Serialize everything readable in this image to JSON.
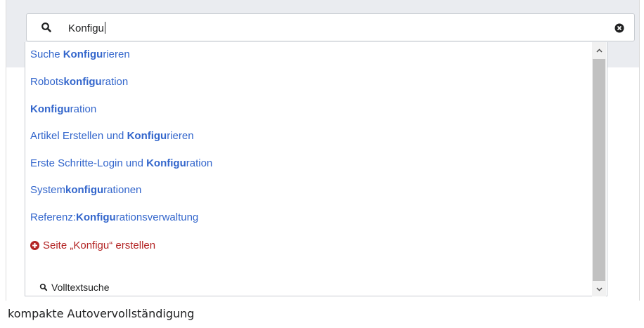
{
  "search": {
    "value": "Konfigu",
    "icon": "search-icon",
    "clear_icon": "clear-icon"
  },
  "suggestions": [
    {
      "pre": "Suche ",
      "match": "Konfigu",
      "post": "rieren"
    },
    {
      "pre": "Robots",
      "match": "konfigu",
      "post": "ration"
    },
    {
      "pre": "",
      "match": "Konfigu",
      "post": "ration"
    },
    {
      "pre": "Artikel Erstellen und ",
      "match": "Konfigu",
      "post": "rieren"
    },
    {
      "pre": "Erste Schritte-Login und ",
      "match": "Konfigu",
      "post": "ration"
    },
    {
      "pre": "System",
      "match": "konfigu",
      "post": "rationen"
    },
    {
      "pre": "Referenz:",
      "match": "Konfigu",
      "post": "rationsverwaltung"
    }
  ],
  "create_page": {
    "label": "Seite „Konfigu“ erstellen",
    "icon": "plus-circle-icon",
    "color": "#b32424"
  },
  "fulltext": {
    "label": "Volltextsuche",
    "icon": "search-icon"
  },
  "caption": "kompakte Autovervollständigung",
  "colors": {
    "link": "#3366cc",
    "band": "#eaecf0",
    "border": "#c8ccd1"
  }
}
